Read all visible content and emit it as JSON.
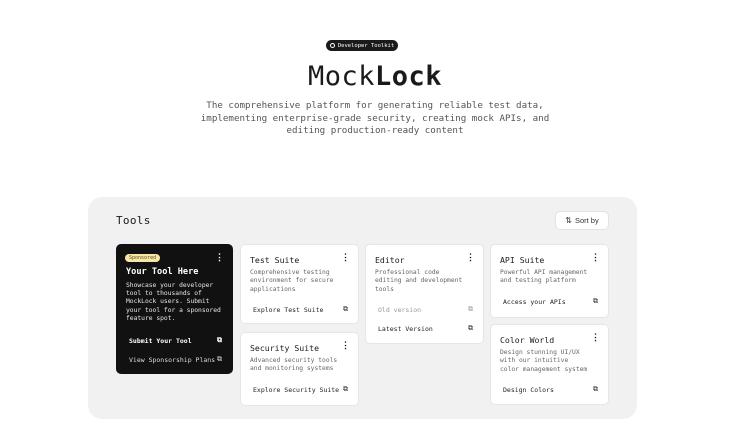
{
  "badge": {
    "label": "Developer Toolkit"
  },
  "hero": {
    "title_light": "Mock",
    "title_bold": "Lock",
    "subtitle": "The comprehensive platform for generating reliable test data, implementing enterprise-grade security, creating mock APIs, and editing production-ready content"
  },
  "tools": {
    "heading": "Tools",
    "sort_label": "Sort by",
    "sponsored": {
      "badge": "Sponsored",
      "title": "Your Tool Here",
      "description": "Showcase your developer tool to thousands of MockLock users. Submit your tool for a sponsored feature spot.",
      "primary_link": "Submit Your Tool",
      "secondary_link": "View Sponsorship Plans"
    },
    "test_suite": {
      "title": "Test Suite",
      "description": "Comprehensive testing environment for secure applications",
      "link": "Explore Test Suite"
    },
    "security_suite": {
      "title": "Security Suite",
      "description": "Advanced security tools and monitoring systems",
      "link": "Explore Security Suite"
    },
    "editor": {
      "title": "Editor",
      "description": "Professional code editing and development tools",
      "old_link": "Old version",
      "latest_link": "Latest Version"
    },
    "api_suite": {
      "title": "API Suite",
      "description": "Powerful API management and testing platform",
      "link": "Access your APIs"
    },
    "color_world": {
      "title": "Color World",
      "description": "Design stunning UI/UX with our intuitive color management system",
      "link": "Design Colors"
    },
    "icons": {
      "menu": "⋮",
      "external": "⧉",
      "sort": "⇅"
    }
  }
}
